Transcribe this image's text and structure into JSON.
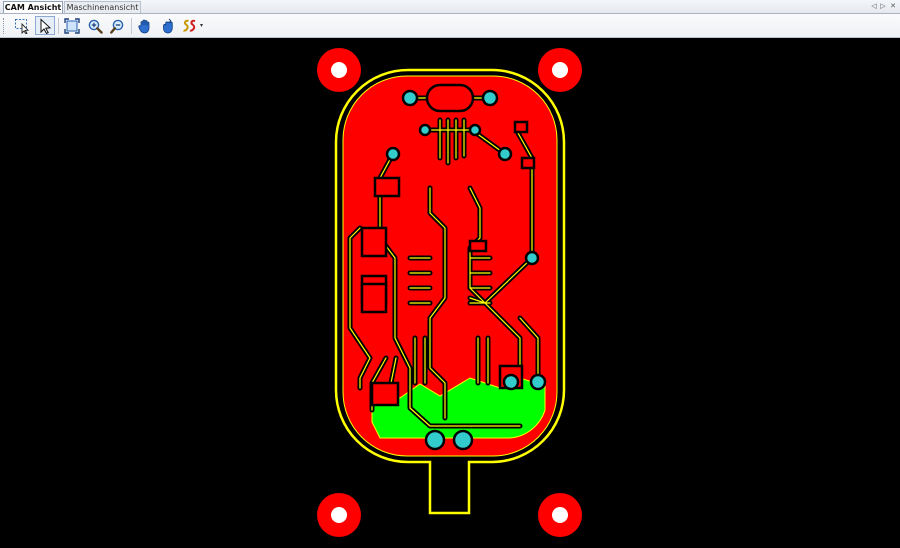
{
  "tabs": [
    {
      "label": "CAM Ansicht",
      "active": true
    },
    {
      "label": "Maschinenansicht",
      "active": false
    }
  ],
  "tab_controls": [
    "◁",
    "▷",
    "✕"
  ],
  "toolbar": {
    "tools": [
      {
        "icon": "lasso-select-icon"
      },
      {
        "icon": "pointer-select-icon",
        "selected": true
      },
      {
        "icon": "zoom-fit-icon"
      },
      {
        "icon": "zoom-in-icon"
      },
      {
        "icon": "zoom-out-icon"
      },
      {
        "icon": "pan-hand-icon"
      },
      {
        "icon": "grab-hand-icon"
      },
      {
        "icon": "route-path-icon"
      }
    ],
    "dropdown_arrow": "▾"
  },
  "colors": {
    "background": "#000000",
    "copper": "#ff0000",
    "copper_bottom": "#00ff00",
    "trace_outline": "#ffff00",
    "board_outline": "#ffff00",
    "drill": "#33cccc",
    "mounting_hole": "#ffffff"
  }
}
